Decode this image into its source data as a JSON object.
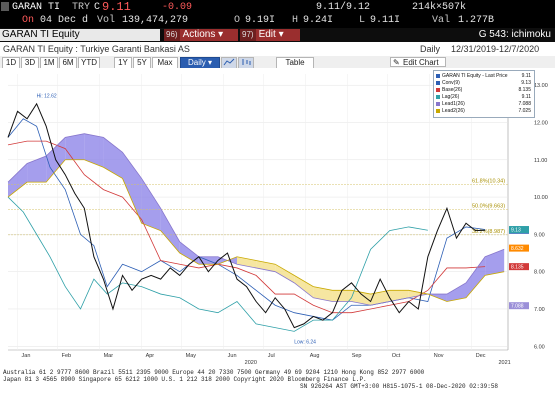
{
  "quote": {
    "ticker": "GARAN TI",
    "currency": "TRY",
    "flag": "C",
    "price": "9.11",
    "change": "-0.09",
    "bid_ask": "9.11/9.12",
    "size": "214k×507k",
    "on_label": "On",
    "date": "04 Dec d",
    "vol_label": "Vol",
    "volume": "139,474,279",
    "open_label": "O",
    "open": "9.19I",
    "high_label": "H",
    "high": "9.24I",
    "low_label": "L",
    "low": "9.11I",
    "val_label": "Val",
    "val": "1.277B"
  },
  "title_bar": {
    "security": "GARAN TI Equity",
    "actions_num": "96)",
    "actions_label": "Actions ▾",
    "edit_num": "97)",
    "edit_label": "Edit ▾",
    "study_label": "G 543: ichimoku"
  },
  "sub_bar": {
    "description": "GARAN TI Equity : Turkiye Garanti Bankasi AS",
    "frequency": "Daily",
    "date_range": "12/31/2019-12/7/2020"
  },
  "toolbar": {
    "periods": [
      "1D",
      "3D",
      "1M",
      "6M",
      "YTD",
      "1Y",
      "5Y",
      "Max"
    ],
    "frequency_select": "Daily ▾",
    "table_label": "Table",
    "edit_chart_label": "Edit Chart"
  },
  "chart_data": {
    "type": "line",
    "ylim": [
      5.9,
      13.3
    ],
    "y_ticks": [
      "13.00",
      "12.00",
      "11.00",
      "10.00",
      "9.00",
      "8.00",
      "7.00",
      "6.00"
    ],
    "x_ticks": [
      "Jan",
      "Feb",
      "Mar",
      "Apr",
      "May",
      "Jun",
      "Jul",
      "Aug",
      "Sep",
      "Oct",
      "Nov",
      "Dec"
    ],
    "year_labels": [
      "2020",
      "2021"
    ],
    "high_label": "Hi: 12.62",
    "low_label": "Low: 6.24",
    "fib_levels": [
      {
        "label": "61.8%(10.34)",
        "value": 10.34
      },
      {
        "label": "50.0%(9.663)",
        "value": 9.663
      },
      {
        "label": "38.2%(8.987)",
        "value": 8.987
      }
    ],
    "price_tags": [
      {
        "label": "9.11",
        "value": 9.11,
        "color": "#2d5fb5"
      },
      {
        "label": "9.13",
        "value": 9.13,
        "color": "#2fa0a8"
      },
      {
        "label": "8.632",
        "value": 8.632,
        "color": "#ff8a00"
      },
      {
        "label": "8.135",
        "value": 8.135,
        "color": "#d23a3a"
      },
      {
        "label": "7.088",
        "value": 7.088,
        "color": "#9b8fd8"
      }
    ],
    "legend_title": "GARAN TI Equity - Last Price",
    "legend_title_value": "9.11",
    "series": [
      {
        "name": "Conv(9)",
        "value": "9.13",
        "color": "#2d5fb5",
        "x": [
          0,
          8,
          15,
          22,
          30,
          38,
          45,
          52,
          60,
          70,
          80,
          90,
          100,
          110,
          120,
          130,
          140,
          150,
          160,
          170,
          180,
          190,
          200,
          210,
          220,
          230,
          240,
          250
        ],
        "values": [
          11.6,
          12.1,
          11.9,
          10.8,
          10.2,
          9.0,
          8.7,
          7.6,
          8.2,
          8.0,
          8.3,
          8.0,
          8.4,
          8.2,
          7.9,
          7.5,
          7.1,
          6.9,
          6.8,
          6.7,
          7.1,
          7.1,
          7.2,
          7.3,
          7.2,
          8.9,
          9.2,
          9.13
        ]
      },
      {
        "name": "Base(26)",
        "value": "8.135",
        "color": "#d23a3a",
        "x": [
          0,
          10,
          20,
          30,
          40,
          50,
          60,
          70,
          80,
          90,
          100,
          110,
          120,
          130,
          140,
          150,
          160,
          170,
          180,
          190,
          200,
          210,
          220,
          230,
          240,
          250
        ],
        "values": [
          11.4,
          11.5,
          11.5,
          11.3,
          10.6,
          10.2,
          10.0,
          9.4,
          8.3,
          8.2,
          8.1,
          8.2,
          8.1,
          7.9,
          7.4,
          7.4,
          7.1,
          6.9,
          6.9,
          7.0,
          7.1,
          7.2,
          7.5,
          8.1,
          8.1,
          8.135
        ]
      },
      {
        "name": "Lag(26)",
        "value": "9.11",
        "color": "#2fa0a8",
        "x": [
          0,
          8,
          15,
          22,
          30,
          38,
          45,
          52,
          60,
          70,
          80,
          90,
          100,
          110,
          120,
          130,
          140,
          150,
          160,
          170,
          180,
          190,
          200,
          210,
          220
        ],
        "values": [
          10.0,
          9.6,
          9.0,
          8.4,
          7.6,
          7.0,
          7.8,
          7.4,
          7.7,
          7.6,
          7.4,
          7.3,
          7.0,
          6.9,
          7.2,
          6.6,
          6.5,
          6.4,
          6.7,
          6.7,
          7.3,
          8.6,
          9.1,
          9.2,
          9.11
        ]
      },
      {
        "name": "Lead1(26)",
        "value": "7.088",
        "color": "#8877cc",
        "x": [
          0,
          10,
          20,
          30,
          40,
          50,
          60,
          70,
          80,
          90,
          100,
          110,
          120,
          130,
          140,
          150,
          160,
          170,
          180,
          190,
          200,
          210,
          220,
          230,
          240,
          250,
          260
        ],
        "values": [
          10.4,
          10.9,
          11.1,
          11.6,
          11.7,
          11.6,
          11.2,
          10.5,
          9.7,
          8.8,
          8.4,
          8.4,
          8.2,
          8.1,
          8.0,
          7.7,
          7.3,
          7.2,
          7.2,
          7.1,
          7.2,
          7.3,
          7.4,
          7.4,
          7.7,
          8.4,
          8.6
        ]
      },
      {
        "name": "Lead2(26)",
        "value": "7.025",
        "color": "#c8a800",
        "x": [
          0,
          10,
          20,
          30,
          40,
          50,
          60,
          70,
          80,
          90,
          100,
          110,
          120,
          130,
          140,
          150,
          160,
          170,
          180,
          190,
          200,
          210,
          220,
          230,
          240,
          250,
          260
        ],
        "values": [
          10.0,
          10.4,
          10.4,
          11.0,
          11.0,
          10.8,
          10.5,
          9.3,
          9.1,
          8.5,
          8.2,
          8.2,
          8.4,
          8.3,
          8.2,
          7.9,
          7.6,
          7.5,
          7.5,
          7.4,
          7.5,
          7.5,
          7.4,
          7.2,
          7.3,
          7.9,
          8.0
        ]
      },
      {
        "name": "Last Price",
        "value": "9.11",
        "color": "#111111",
        "x": [
          0,
          5,
          10,
          15,
          20,
          25,
          30,
          35,
          40,
          45,
          50,
          55,
          60,
          65,
          70,
          75,
          80,
          85,
          90,
          95,
          100,
          105,
          110,
          115,
          120,
          125,
          130,
          135,
          140,
          145,
          150,
          155,
          160,
          165,
          170,
          175,
          180,
          185,
          190,
          195,
          200,
          205,
          210,
          215,
          220,
          225,
          230,
          235,
          240,
          245,
          250
        ],
        "values": [
          11.6,
          12.3,
          12.1,
          12.5,
          11.9,
          11.0,
          10.6,
          10.1,
          9.7,
          8.4,
          7.8,
          7.0,
          7.9,
          7.5,
          7.8,
          7.9,
          7.8,
          8.1,
          7.9,
          8.2,
          8.4,
          8.0,
          8.3,
          8.5,
          7.8,
          7.6,
          7.2,
          6.9,
          7.3,
          7.0,
          6.5,
          6.6,
          6.8,
          6.7,
          6.9,
          7.5,
          7.7,
          7.4,
          7.2,
          7.8,
          7.3,
          6.9,
          7.2,
          7.0,
          8.4,
          9.1,
          9.7,
          8.9,
          9.3,
          9.1,
          9.11
        ]
      }
    ]
  },
  "footer": {
    "line1": "Australia 61 2 9777 8600 Brazil 5511 2395 9000 Europe 44 20 7330 7500 Germany 49 69 9204 1210 Hong Kong 852 2977 6000",
    "line2": "Japan 81 3 4565 8900          Singapore 65 6212 1000       U.S. 1 212 318 2000          Copyright 2020 Bloomberg Finance L.P.",
    "line3": "SN 926264 AST  GMT+3:00 H815-1075-1 08-Dec-2020 02:39:58"
  }
}
